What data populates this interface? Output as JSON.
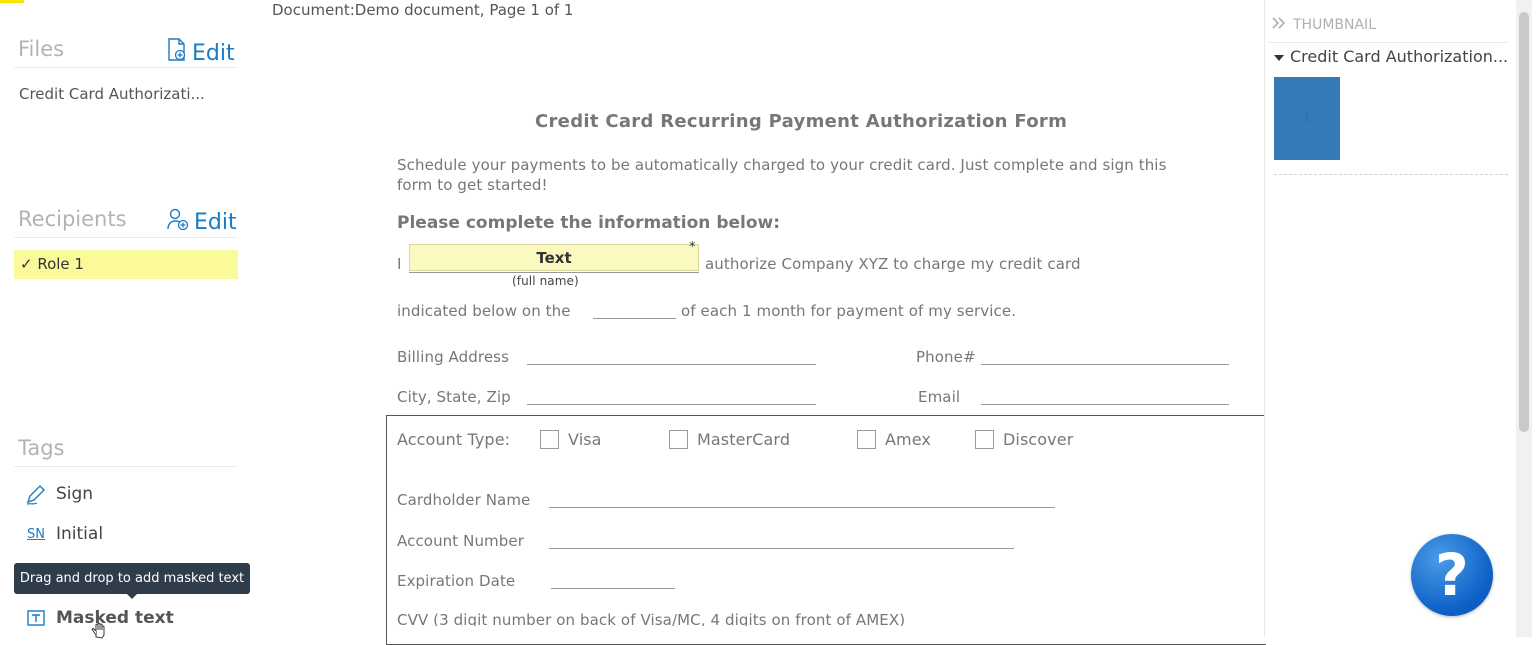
{
  "left_panel": {
    "files": {
      "title": "Files",
      "edit_label": "Edit",
      "items": [
        "Credit Card Authorizati..."
      ]
    },
    "recipients": {
      "title": "Recipients",
      "edit_label": "Edit",
      "items": [
        "✓ Role 1"
      ]
    },
    "tags": {
      "title": "Tags",
      "items": [
        {
          "label": "Sign",
          "icon": "pen-icon"
        },
        {
          "label": "Initial",
          "icon": "initial-icon",
          "icon_text": "SN"
        },
        {
          "label": "Masked text",
          "icon": "masked-text-icon"
        }
      ],
      "tooltip": "Drag and drop to add masked text"
    }
  },
  "document": {
    "header": "Document:Demo document, Page 1 of 1",
    "title": "Credit Card Recurring Payment Authorization Form",
    "intro_line1": "Schedule your payments to be automatically charged to your credit card.  Just complete and sign this",
    "intro_line2": "form to get started!",
    "subhead": "Please complete the information below:",
    "i_label": "I",
    "text_field": {
      "label": "Text",
      "required_mark": "*"
    },
    "full_name_caption": "(full name)",
    "authorize_text": "authorize Company XYZ to charge my credit card",
    "indicated_left": "indicated below on the",
    "indicated_right": "of each 1 month for payment of my service.",
    "billing_label": "Billing Address",
    "phone_label": "Phone#",
    "city_label": "City, State, Zip",
    "email_label": "Email",
    "account_type_label": "Account Type:",
    "card_types": [
      "Visa",
      "MasterCard",
      "Amex",
      "Discover"
    ],
    "cardholder_label": "Cardholder Name",
    "account_number_label": "Account Number",
    "expiration_label": "Expiration Date",
    "cvv_label": "CVV (3 digit number on back of Visa/MC, 4 digits on front of AMEX)"
  },
  "thumbnail_panel": {
    "title": "THUMBNAIL",
    "doc_name": "Credit Card Authorization...",
    "page_number": "1"
  },
  "help": {
    "glyph": "?"
  },
  "colors": {
    "accent": "#1a7cc6",
    "role_highlight": "#fafa9a",
    "field_fill": "#fafac0",
    "thumb": "#337ab7",
    "tooltip_bg": "#2f3d4b"
  }
}
